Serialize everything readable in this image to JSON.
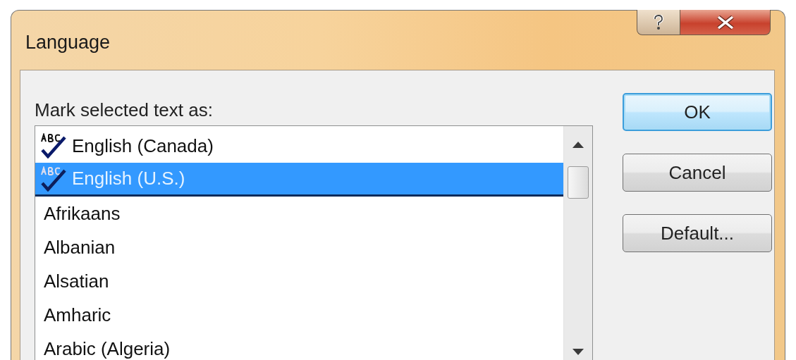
{
  "window": {
    "title": "Language"
  },
  "label": "Mark selected text as:",
  "languages": [
    {
      "name": "English (Canada)",
      "spellcheck": true,
      "selected": false
    },
    {
      "name": "English (U.S.)",
      "spellcheck": true,
      "selected": true
    },
    {
      "name": "Afrikaans",
      "spellcheck": false,
      "selected": false
    },
    {
      "name": "Albanian",
      "spellcheck": false,
      "selected": false
    },
    {
      "name": "Alsatian",
      "spellcheck": false,
      "selected": false
    },
    {
      "name": "Amharic",
      "spellcheck": false,
      "selected": false
    },
    {
      "name": "Arabic (Algeria)",
      "spellcheck": false,
      "selected": false
    }
  ],
  "buttons": [
    {
      "label": "OK",
      "default": true
    },
    {
      "label": "Cancel",
      "default": false
    },
    {
      "label": "Default...",
      "default": false
    }
  ]
}
